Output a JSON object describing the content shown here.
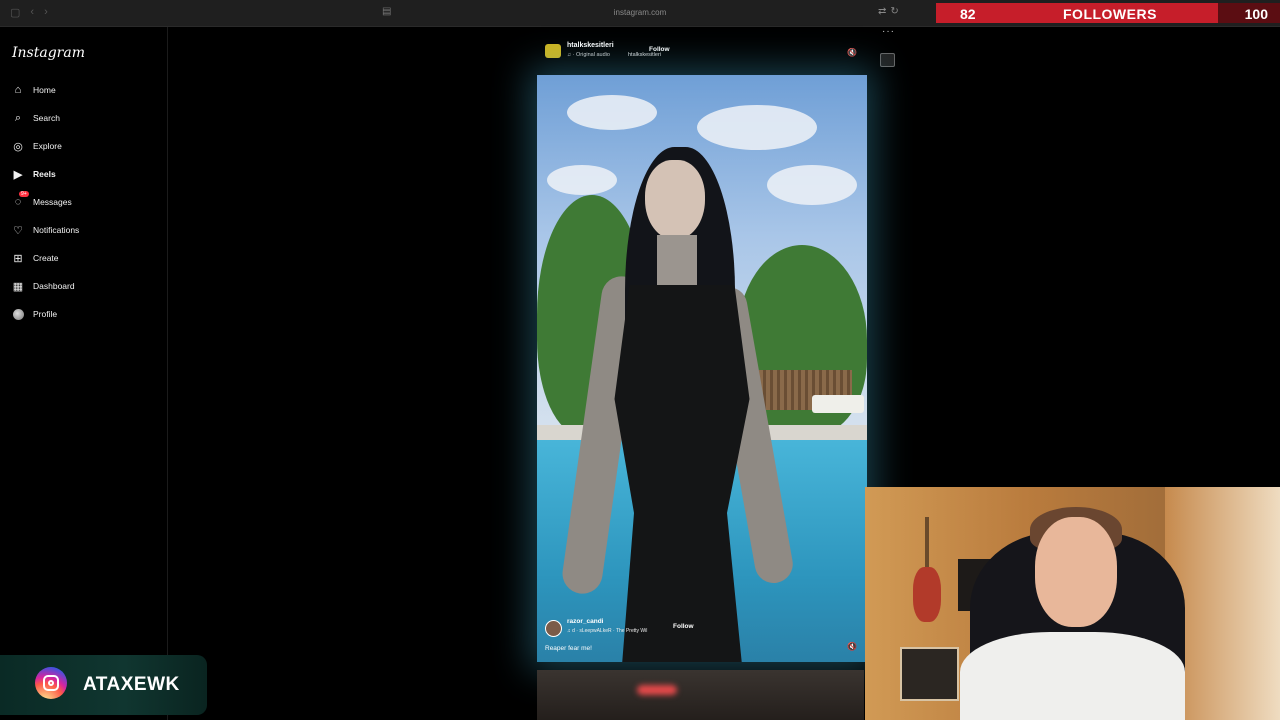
{
  "browser": {
    "url": "instagram.com"
  },
  "followers": {
    "current": "82",
    "label": "FOLLOWERS",
    "goal": "100",
    "progress": 0.82,
    "fill_color": "#c61e2a",
    "track_color": "#5b0d12"
  },
  "sidebar": {
    "logo": "Instagram",
    "items": [
      {
        "label": "Home",
        "icon": "home-icon"
      },
      {
        "label": "Search",
        "icon": "search-icon"
      },
      {
        "label": "Explore",
        "icon": "compass-icon"
      },
      {
        "label": "Reels",
        "icon": "reels-icon"
      },
      {
        "label": "Messages",
        "icon": "messenger-icon",
        "badge": "9+"
      },
      {
        "label": "Notifications",
        "icon": "heart-icon"
      },
      {
        "label": "Create",
        "icon": "plus-square-icon"
      },
      {
        "label": "Dashboard",
        "icon": "dashboard-icon"
      },
      {
        "label": "Profile",
        "icon": "avatar"
      }
    ]
  },
  "reel": {
    "header_user": "htalkskesitleri",
    "header_follow": "Follow",
    "header_audio": "♫ · Original audio",
    "header_audio_user": "htalkskesitleri",
    "caption_user": "razor_candi",
    "caption_track": "♫ d · sLeepwALkeR · The Pretty Wil",
    "caption_follow": "Follow",
    "caption_text": "Reaper fear me!"
  },
  "overlay": {
    "handle": "ATAXEWK"
  }
}
